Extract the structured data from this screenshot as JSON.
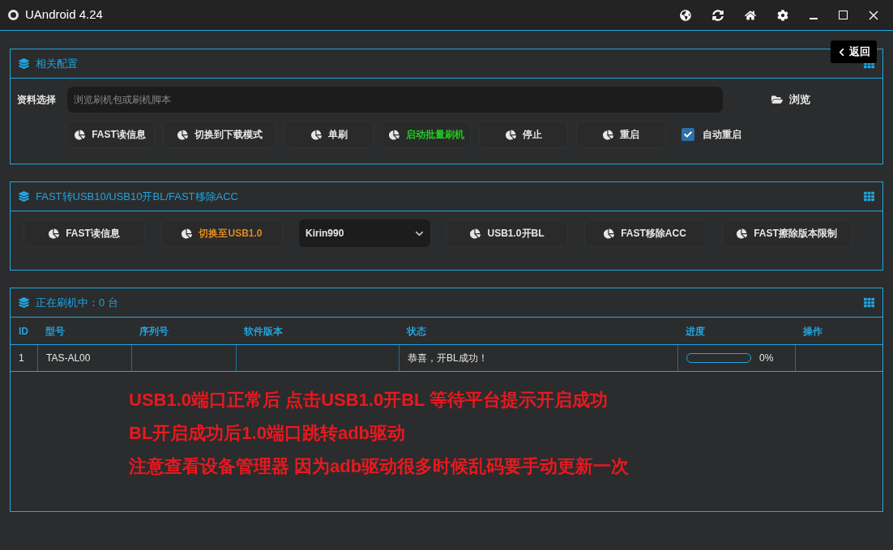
{
  "window": {
    "title": "UAndroid 4.24"
  },
  "back_button": {
    "label": "返回"
  },
  "config_panel": {
    "title": "相关配置",
    "file_label": "资料选择",
    "file_field": {
      "placeholder": "浏览刷机包或刷机脚本"
    },
    "browse_button": "浏览",
    "buttons": [
      {
        "label": "FAST读信息",
        "color": "#e6e6e6"
      },
      {
        "label": "切换到下载模式",
        "color": "#e6e6e6"
      },
      {
        "label": "单刷",
        "color": "#e6e6e6"
      },
      {
        "label": "启动批量刷机",
        "color": "#22cc22"
      },
      {
        "label": "停止",
        "color": "#e6e6e6"
      },
      {
        "label": "重启",
        "color": "#e6e6e6"
      }
    ],
    "auto_restart": {
      "label": "自动重启",
      "checked": true
    }
  },
  "fast_panel": {
    "title": "FAST转USB10/USB10开BL/FAST移除ACC",
    "items": [
      {
        "kind": "button",
        "label": "FAST读信息",
        "color": "#e6e6e6"
      },
      {
        "kind": "button",
        "label": "切换至USB1.0",
        "color": "#e08a1e"
      },
      {
        "kind": "select",
        "label": "Kirin990"
      },
      {
        "kind": "button",
        "label": "USB1.0开BL",
        "color": "#e6e6e6"
      },
      {
        "kind": "button",
        "label": "FAST移除ACC",
        "color": "#e6e6e6"
      },
      {
        "kind": "button",
        "label": "FAST擦除版本限制",
        "color": "#e6e6e6"
      }
    ]
  },
  "flash_panel": {
    "title": "正在刷机中：0 台",
    "table": {
      "columns": [
        "ID",
        "型号",
        "序列号",
        "软件版本",
        "状态",
        "进度",
        "操作"
      ],
      "rows": [
        {
          "id": "1",
          "model": "TAS-AL00",
          "serial": "",
          "version": "",
          "status": "恭喜，开BL成功！",
          "level": 0,
          "progress": "0%",
          "action": ""
        }
      ]
    },
    "notes": [
      "USB1.0端口正常后 点击USB1.0开BL 等待平台提示开启成功",
      "BL开启成功后1.0端口跳转adb驱动",
      "注意查看设备管理器 因为adb驱动很多时候乱码要手动更新一次"
    ]
  }
}
